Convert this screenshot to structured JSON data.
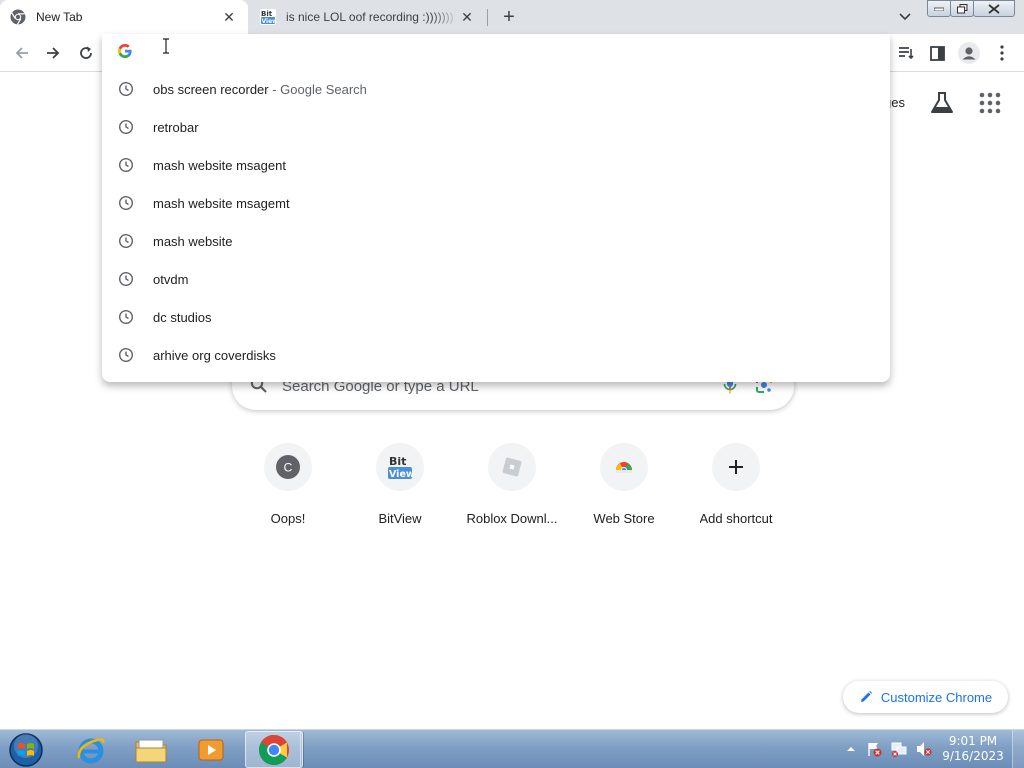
{
  "tabs": [
    {
      "title": "New Tab",
      "favicon": "chrome-icon",
      "active": true
    },
    {
      "title": "is nice LOL oof recording :))))))) - BitView",
      "favicon": "bitview-icon",
      "active": false
    }
  ],
  "omnibox": {
    "value": "",
    "suggestions": [
      {
        "text": "obs screen recorder",
        "sub": " - Google Search"
      },
      {
        "text": "retrobar",
        "sub": ""
      },
      {
        "text": "mash website msagent",
        "sub": ""
      },
      {
        "text": "mash website msagemt",
        "sub": ""
      },
      {
        "text": "mash website",
        "sub": ""
      },
      {
        "text": "otvdm",
        "sub": ""
      },
      {
        "text": "dc studios",
        "sub": ""
      },
      {
        "text": "arhive org coverdisks",
        "sub": ""
      }
    ]
  },
  "ntp": {
    "top_link_partial": "ges",
    "search_placeholder": "Search Google or type a URL",
    "shortcuts": [
      {
        "label": "Oops!",
        "icon_letter": "C"
      },
      {
        "label": "BitView",
        "icon_letter": "Bit View"
      },
      {
        "label": "Roblox Downl...",
        "icon_letter": ""
      },
      {
        "label": "Web Store",
        "icon_letter": ""
      },
      {
        "label": "Add shortcut",
        "icon_letter": "+"
      }
    ],
    "customize_label": "Customize Chrome"
  },
  "taskbar": {
    "time": "9:01 PM",
    "date": "9/16/2023"
  },
  "colors": {
    "accent": "#1a73e8",
    "tabstrip": "#dee1e6",
    "taskbar": "#7f9fc4"
  }
}
